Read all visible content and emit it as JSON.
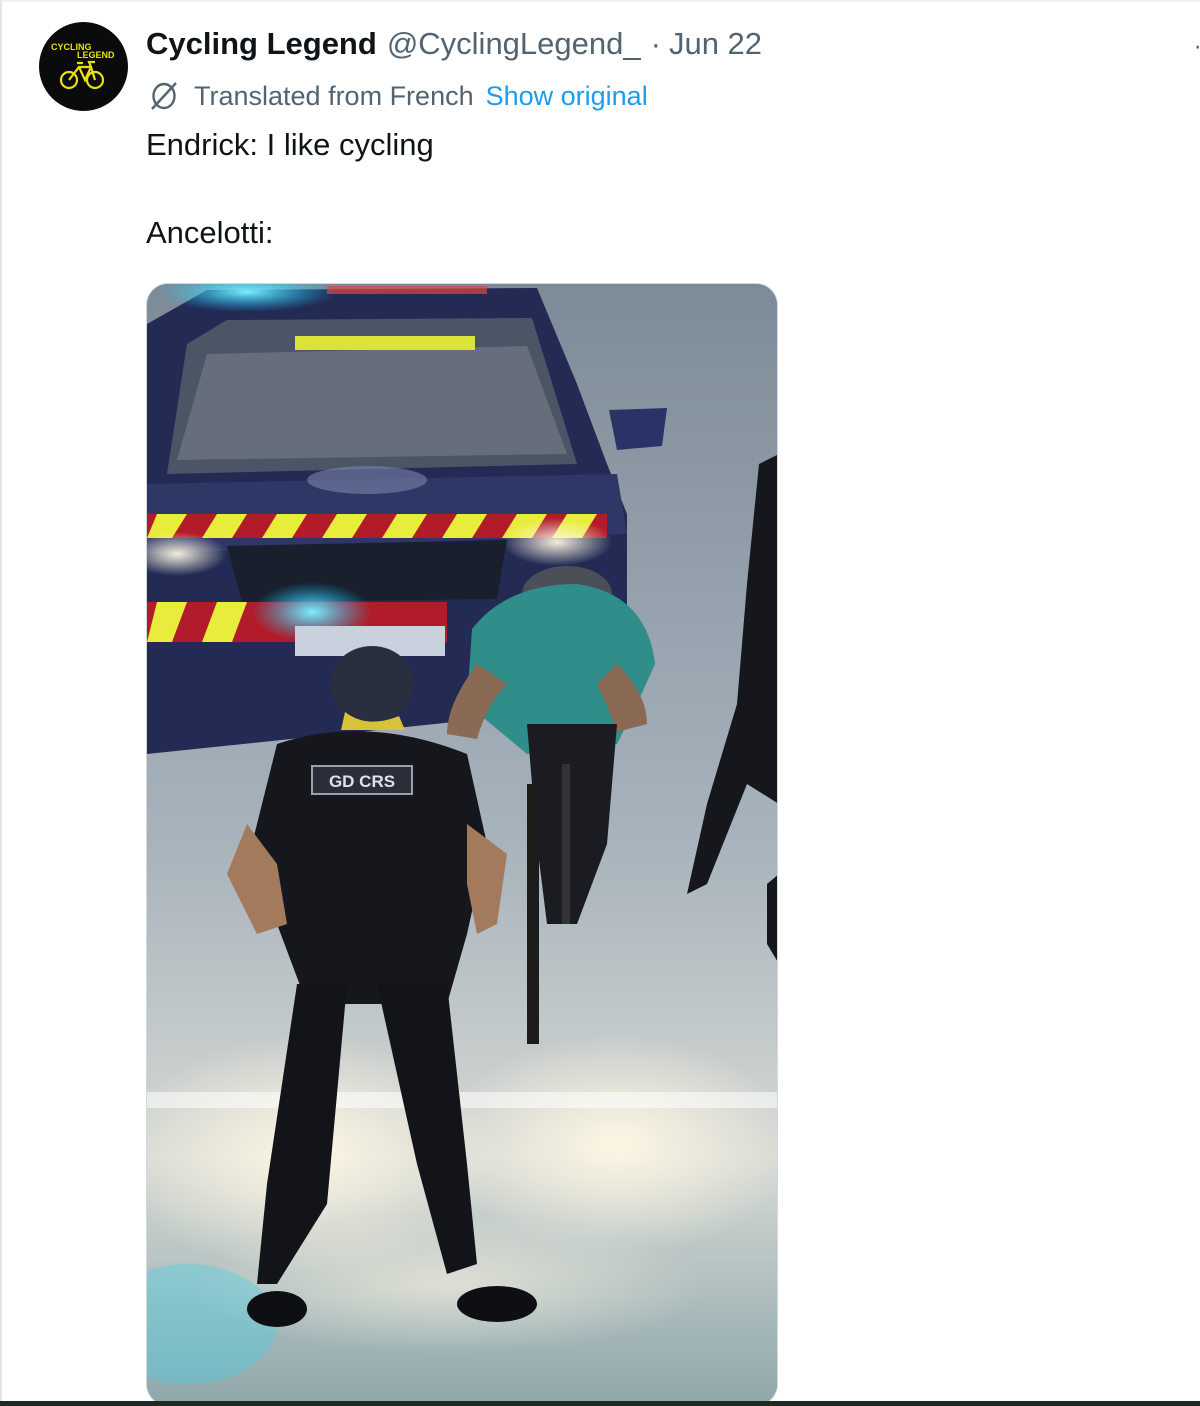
{
  "tweet": {
    "author": {
      "display_name": "Cycling Legend",
      "handle": "@CyclingLegend_",
      "avatar_text_line1": "CYCLING",
      "avatar_text_line2": "LEGEND"
    },
    "separator": "·",
    "date": "Jun 22",
    "translation": {
      "icon": "translate-globe-icon",
      "label": "Translated from French",
      "show_original": "Show original"
    },
    "text_lines": [
      "Endrick: I like cycling",
      "Ancelotti:"
    ],
    "media": {
      "type": "video",
      "visible_text": [
        "GD CRS"
      ]
    }
  },
  "colors": {
    "primary_text": "#0f1419",
    "secondary_text": "#536471",
    "link": "#1d9bf0",
    "avatar_bg": "#0b0b0b",
    "avatar_accent": "#e8e20c"
  }
}
